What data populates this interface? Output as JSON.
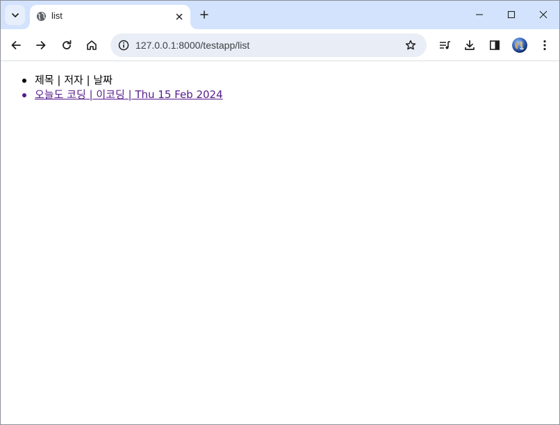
{
  "browser": {
    "tab_title": "list",
    "url": "127.0.0.1:8000/testapp/list"
  },
  "list": {
    "header": "제목 | 저자 | 날짜",
    "items": [
      {
        "label": "오늘도 코딩 | 이코딩 | Thu 15 Feb 2024"
      }
    ]
  },
  "colors": {
    "tabstrip": "#d3e3fd",
    "omnibox": "#e9eef6",
    "visited_link": "#551a8b"
  },
  "icons": [
    "tab-search-icon",
    "globe-icon",
    "close-icon",
    "plus-icon",
    "minimize-icon",
    "maximize-icon",
    "window-close-icon",
    "back-arrow-icon",
    "forward-arrow-icon",
    "reload-icon",
    "home-icon",
    "info-icon",
    "star-icon",
    "media-control-icon",
    "download-icon",
    "side-panel-icon",
    "profile-avatar-icon",
    "more-menu-icon"
  ]
}
